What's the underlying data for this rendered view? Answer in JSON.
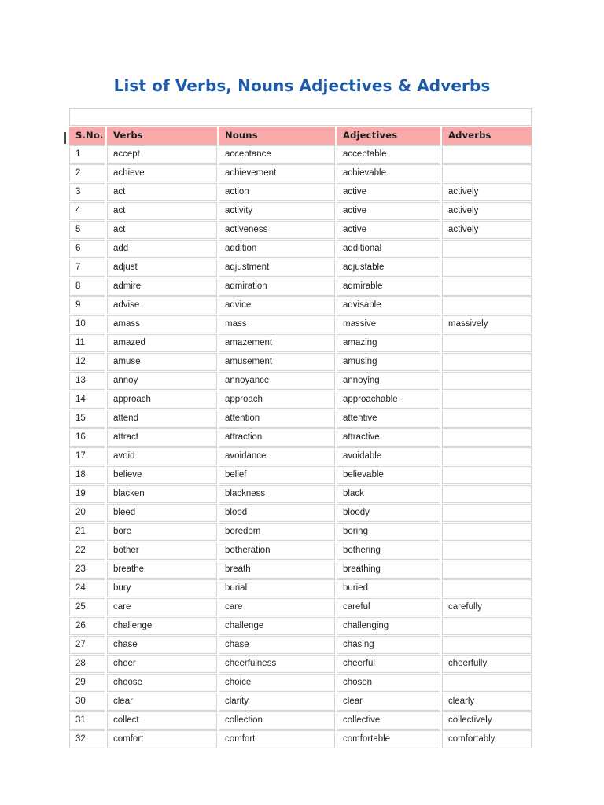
{
  "document": {
    "title": "List of Verbs, Nouns Adjectives & Adverbs",
    "title_color": "#1d5ba8",
    "header_bg_color": "#f9a9a9",
    "cell_border_color": "#d4d4d4",
    "background_color": "#ffffff"
  },
  "table": {
    "spacer_row_text": "",
    "columns": [
      "S.No.",
      "Verbs",
      "Nouns",
      "Adjectives",
      "Adverbs"
    ],
    "rows": [
      [
        "1",
        "accept",
        "acceptance",
        "acceptable",
        ""
      ],
      [
        "2",
        "achieve",
        "achievement",
        "achievable",
        ""
      ],
      [
        "3",
        "act",
        "action",
        "active",
        "actively"
      ],
      [
        "4",
        "act",
        "activity",
        "active",
        "actively"
      ],
      [
        "5",
        "act",
        "activeness",
        "active",
        "actively"
      ],
      [
        "6",
        "add",
        "addition",
        "additional",
        ""
      ],
      [
        "7",
        "adjust",
        "adjustment",
        "adjustable",
        ""
      ],
      [
        "8",
        "admire",
        "admiration",
        "admirable",
        ""
      ],
      [
        "9",
        "advise",
        "advice",
        "advisable",
        ""
      ],
      [
        "10",
        "amass",
        "mass",
        "massive",
        "massively"
      ],
      [
        "11",
        "amazed",
        "amazement",
        "amazing",
        ""
      ],
      [
        "12",
        "amuse",
        "amusement",
        "amusing",
        ""
      ],
      [
        "13",
        "annoy",
        "annoyance",
        "annoying",
        ""
      ],
      [
        "14",
        "approach",
        "approach",
        "approachable",
        ""
      ],
      [
        "15",
        "attend",
        "attention",
        "attentive",
        ""
      ],
      [
        "16",
        "attract",
        "attraction",
        "attractive",
        ""
      ],
      [
        "17",
        "avoid",
        "avoidance",
        "avoidable",
        ""
      ],
      [
        "18",
        "believe",
        "belief",
        "believable",
        ""
      ],
      [
        "19",
        "blacken",
        "blackness",
        "black",
        ""
      ],
      [
        "20",
        "bleed",
        "blood",
        "bloody",
        ""
      ],
      [
        "21",
        "bore",
        "boredom",
        "boring",
        ""
      ],
      [
        "22",
        "bother",
        "botheration",
        "bothering",
        ""
      ],
      [
        "23",
        "breathe",
        "breath",
        "breathing",
        ""
      ],
      [
        "24",
        "bury",
        "burial",
        "buried",
        ""
      ],
      [
        "25",
        "care",
        "care",
        "careful",
        "carefully"
      ],
      [
        "26",
        "challenge",
        "challenge",
        "challenging",
        ""
      ],
      [
        "27",
        "chase",
        "chase",
        "chasing",
        ""
      ],
      [
        "28",
        "cheer",
        "cheerfulness",
        "cheerful",
        "cheerfully"
      ],
      [
        "29",
        "choose",
        "choice",
        "chosen",
        ""
      ],
      [
        "30",
        "clear",
        "clarity",
        "clear",
        "clearly"
      ],
      [
        "31",
        "collect",
        "collection",
        "collective",
        "collectively"
      ],
      [
        "32",
        "comfort",
        "comfort",
        "comfortable",
        "comfortably"
      ]
    ]
  }
}
